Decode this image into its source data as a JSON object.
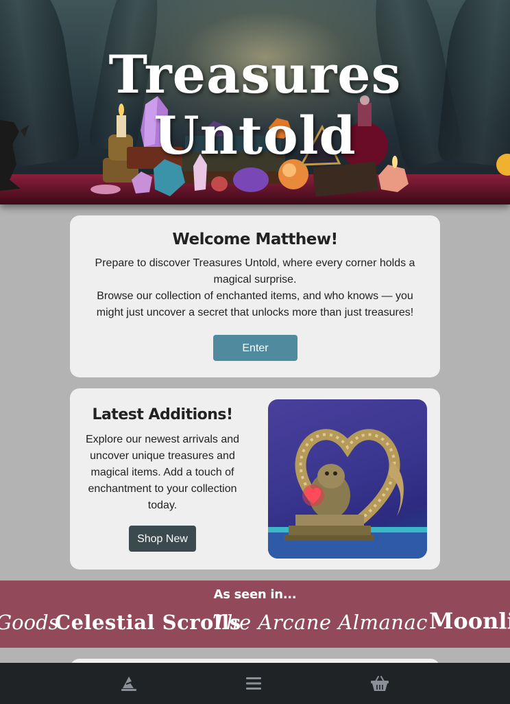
{
  "hero": {
    "title": "Treasures Untold"
  },
  "welcome": {
    "title": "Welcome Matthew!",
    "line1": "Prepare to discover Treasures Untold, where every corner holds a magical surprise.",
    "line2": "Browse our collection of enchanted items, and who knows — you might just uncover a secret that unlocks more than just treasures!",
    "button_label": "Enter"
  },
  "latest": {
    "title": "Latest Additions!",
    "text": "Explore our newest arrivals and uncover unique treasures and magical items. Add a touch of enchantment to your collection today.",
    "button_label": "Shop New",
    "image_icon": "golden-idol-statue-image"
  },
  "seen_in": {
    "title": "As seen in...",
    "logos": [
      "Goods",
      "Celestial Scrolls",
      "The Arcane Almanac",
      "Moonlit"
    ]
  },
  "nav": {
    "items": [
      {
        "icon": "wizard-hat-icon"
      },
      {
        "icon": "menu-icon"
      },
      {
        "icon": "basket-icon"
      }
    ]
  },
  "colors": {
    "page_background": "#b3b3b3",
    "card_background": "#efefef",
    "enter_button": "#4f8a9e",
    "shop_button": "#3b4a4e",
    "seen_band": "#924a5a",
    "nav_background": "#1f2326"
  }
}
